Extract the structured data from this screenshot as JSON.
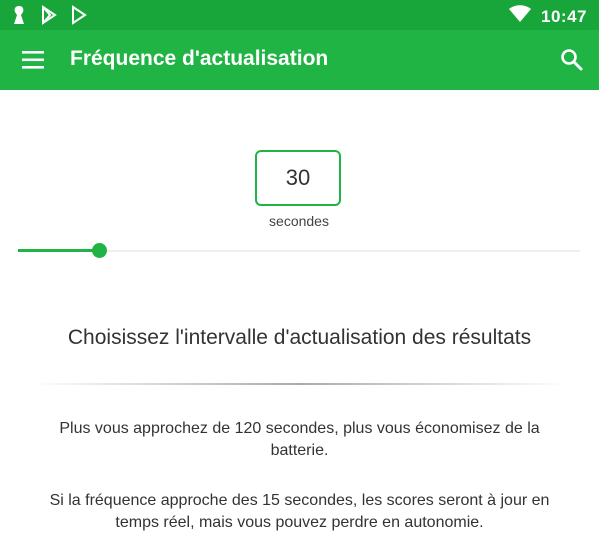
{
  "status_bar": {
    "time": "10:47",
    "icons": [
      "notification-icon",
      "play-store-icon",
      "play-store-icon",
      "wifi-icon",
      "battery-icon"
    ],
    "color": "#18a63a"
  },
  "app_bar": {
    "title": "Fréquence d'actualisation",
    "menu_icon": "hamburger-menu-icon",
    "search_icon": "search-icon",
    "color": "#1fb443"
  },
  "interval": {
    "value": "30",
    "unit": "secondes",
    "slider_fraction": 0.145
  },
  "content": {
    "heading": "Choisissez l'intervalle d'actualisation des résultats",
    "paragraph1": "Plus vous approchez de 120 secondes, plus vous économisez de la batterie.",
    "paragraph2": "Si la fréquence approche des 15 secondes, les scores seront à jour en temps réel, mais vous pouvez perdre en autonomie."
  },
  "colors": {
    "accent": "#1fb443"
  }
}
